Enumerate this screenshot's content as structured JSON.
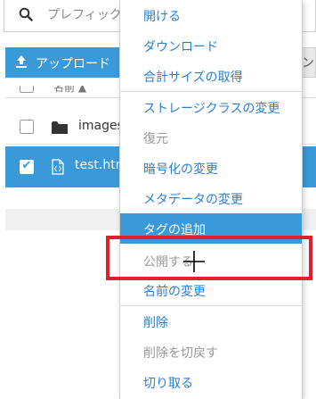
{
  "search": {
    "placeholder": "プレフィック"
  },
  "toolbar": {
    "upload_label": "アップロード",
    "right_button_label": "ン"
  },
  "table": {
    "header_label": "名前 ▲",
    "rows": [
      {
        "name": "images",
        "type": "folder",
        "selected": false
      },
      {
        "name": "test.htm",
        "type": "file",
        "selected": true
      }
    ]
  },
  "context_menu": {
    "items": [
      {
        "label": "開ける",
        "state": "enabled"
      },
      {
        "label": "ダウンロード",
        "state": "enabled"
      },
      {
        "label": "合計サイズの取得",
        "state": "enabled"
      },
      {
        "label": "ストレージクラスの変更",
        "state": "enabled"
      },
      {
        "label": "復元",
        "state": "disabled"
      },
      {
        "label": "暗号化の変更",
        "state": "enabled"
      },
      {
        "label": "メタデータの変更",
        "state": "enabled"
      },
      {
        "label": "タグの追加",
        "state": "highlighted"
      },
      {
        "label": "公開する",
        "state": "disabled"
      },
      {
        "label": "名前の変更",
        "state": "enabled"
      },
      {
        "label": "削除",
        "state": "enabled"
      },
      {
        "label": "削除を切戻す",
        "state": "disabled"
      },
      {
        "label": "切り取る",
        "state": "enabled"
      }
    ]
  },
  "colors": {
    "accent": "#3a9ad9",
    "link": "#2a7fd0",
    "disabled": "#999999",
    "annotation": "#e0202a"
  }
}
